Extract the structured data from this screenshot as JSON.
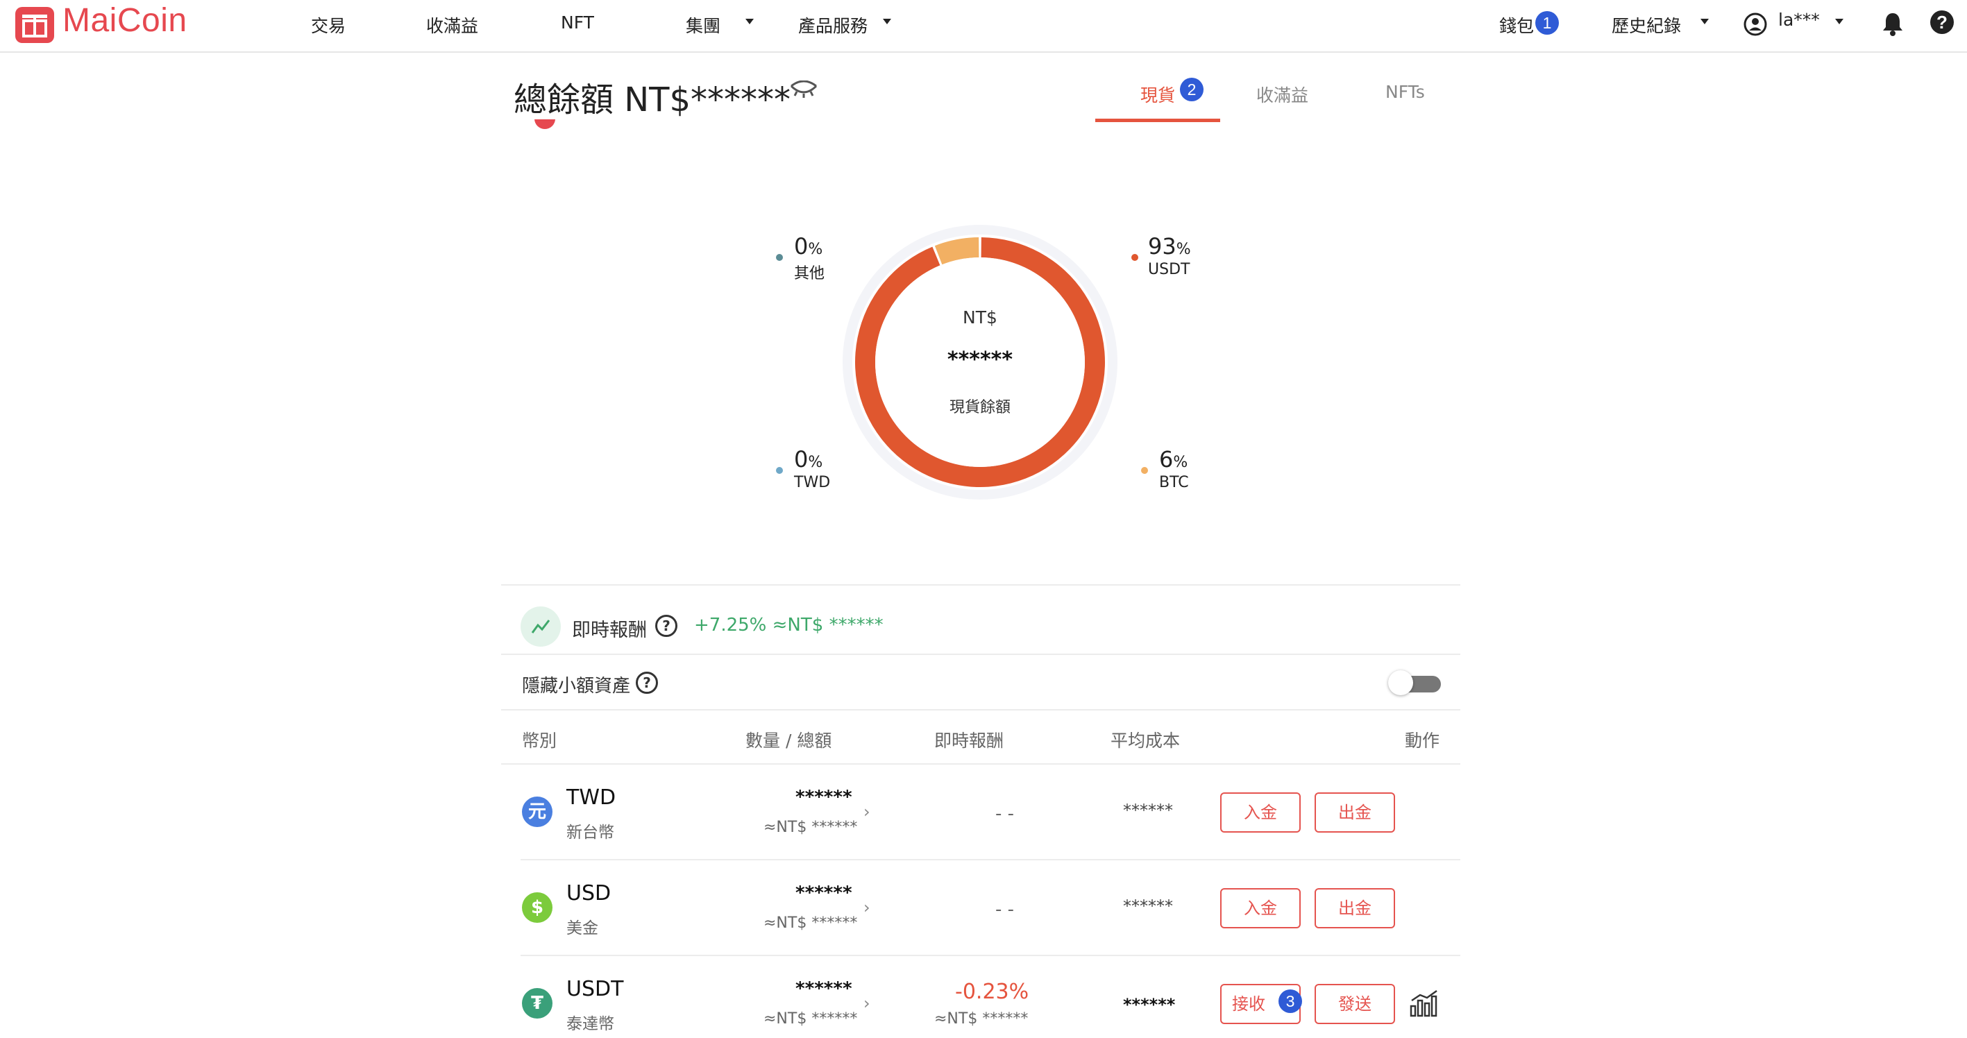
{
  "nav": {
    "brand": "MaiCoin",
    "items": [
      "交易",
      "收滿益",
      "NFT",
      "集團",
      "產品服務"
    ],
    "wallet": "錢包",
    "wallet_badge": "1",
    "history": "歷史紀錄",
    "user": "la***"
  },
  "header": {
    "title": "總餘額 NT$******",
    "tabs": [
      {
        "label": "現貨",
        "badge": "2"
      },
      {
        "label": "收滿益"
      },
      {
        "label": "NFTs"
      }
    ]
  },
  "allocation": {
    "center_currency": "NT$",
    "center_value": "******",
    "center_label": "現貨餘額",
    "legend": [
      {
        "value": "0",
        "unit": "%",
        "name": "其他",
        "color": "#5b8c95"
      },
      {
        "value": "93",
        "unit": "%",
        "name": "USDT",
        "color": "#e0572f"
      },
      {
        "value": "0",
        "unit": "%",
        "name": "TWD",
        "color": "#6fa8c8"
      },
      {
        "value": "6",
        "unit": "%",
        "name": "BTC",
        "color": "#f2b063"
      }
    ]
  },
  "chart_data": {
    "type": "pie",
    "categories": [
      "USDT",
      "BTC",
      "TWD",
      "其他"
    ],
    "values": [
      93,
      6,
      0,
      0
    ],
    "colors": [
      "#e0572f",
      "#f2b063",
      "#6fa8c8",
      "#5b8c95"
    ]
  },
  "returns": {
    "label": "即時報酬",
    "value": "+7.25% ≈NT$ ******"
  },
  "hide_small": {
    "label": "隱藏小額資產"
  },
  "table": {
    "headers": [
      "幣別",
      "數量 / 總額",
      "即時報酬",
      "平均成本",
      "動作"
    ],
    "rows": [
      {
        "symbol": "TWD",
        "name": "新台幣",
        "amount": "******",
        "total": "≈NT$ ******",
        "return": "- -",
        "return_sub": "",
        "cost": "******",
        "action1": "入金",
        "action2": "出金",
        "icon_color": "#4a7fe0",
        "icon_glyph": "元"
      },
      {
        "symbol": "USD",
        "name": "美金",
        "amount": "******",
        "total": "≈NT$ ******",
        "return": "- -",
        "return_sub": "",
        "cost": "******",
        "action1": "入金",
        "action2": "出金",
        "icon_color": "#7ccb3c",
        "icon_glyph": "$"
      },
      {
        "symbol": "USDT",
        "name": "泰達幣",
        "amount": "******",
        "total": "≈NT$ ******",
        "return": "-0.23%",
        "return_sub": "≈NT$ ******",
        "cost": "******",
        "action1": "接收",
        "action1_badge": "3",
        "action2": "發送",
        "icon_color": "#3aa07a",
        "icon_glyph": "₮"
      }
    ]
  }
}
